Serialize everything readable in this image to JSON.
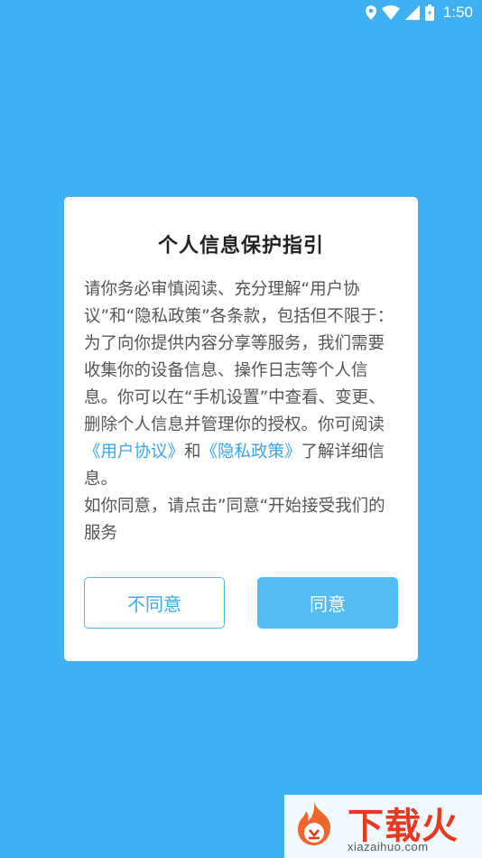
{
  "status_bar": {
    "time": "1:50",
    "icons": [
      "location-icon",
      "wifi-icon",
      "cell-signal-icon",
      "battery-icon"
    ],
    "color": "#ffffff"
  },
  "dialog": {
    "title": "个人信息保护指引",
    "body": {
      "p1_text": "请你务必审慎阅读、充分理解“用户协议”和“隐私政策”各条款，包括但不限于：为了向你提供内容分享等服务，我们需要收集你的设备信息、操作日志等个人信息。你可以在“手机设置”中查看、变更、删除个人信息并管理你的授权。你可阅读",
      "link_user_agreement": "《用户协议》",
      "conjunction": "和",
      "link_privacy_policy": "《隐私政策》",
      "p1_tail": "了解详细信息。",
      "p2_text": "如你同意，请点击”同意“开始接受我们的服务"
    },
    "buttons": {
      "decline": "不同意",
      "agree": "同意"
    }
  },
  "watermark": {
    "brand": "下载火",
    "url": "xiazaihuo.com"
  },
  "colors": {
    "background": "#3fb0f2",
    "accent": "#35a6ee",
    "agree_button": "#52bdf4"
  }
}
